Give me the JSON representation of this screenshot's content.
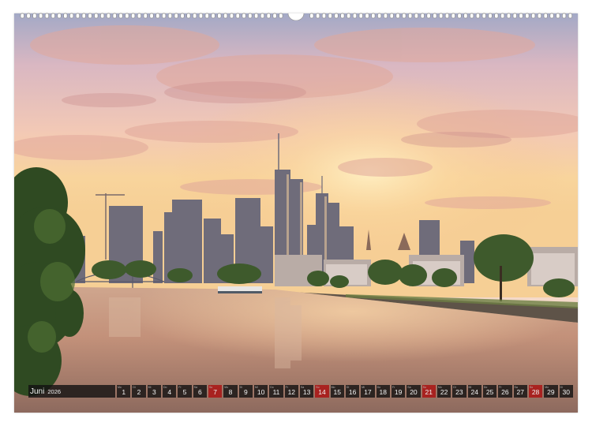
{
  "calendar": {
    "month": "Juni",
    "year": "2026",
    "days": [
      {
        "wd": "Mo",
        "n": "1",
        "sun": false
      },
      {
        "wd": "Di",
        "n": "2",
        "sun": false
      },
      {
        "wd": "Mi",
        "n": "3",
        "sun": false
      },
      {
        "wd": "Do",
        "n": "4",
        "sun": false
      },
      {
        "wd": "Fr",
        "n": "5",
        "sun": false
      },
      {
        "wd": "Sa",
        "n": "6",
        "sun": false
      },
      {
        "wd": "So",
        "n": "7",
        "sun": true
      },
      {
        "wd": "Mo",
        "n": "8",
        "sun": false
      },
      {
        "wd": "Di",
        "n": "9",
        "sun": false
      },
      {
        "wd": "Mi",
        "n": "10",
        "sun": false
      },
      {
        "wd": "Do",
        "n": "11",
        "sun": false
      },
      {
        "wd": "Fr",
        "n": "12",
        "sun": false
      },
      {
        "wd": "Sa",
        "n": "13",
        "sun": false
      },
      {
        "wd": "So",
        "n": "14",
        "sun": true
      },
      {
        "wd": "Mo",
        "n": "15",
        "sun": false
      },
      {
        "wd": "Di",
        "n": "16",
        "sun": false
      },
      {
        "wd": "Mi",
        "n": "17",
        "sun": false
      },
      {
        "wd": "Do",
        "n": "18",
        "sun": false
      },
      {
        "wd": "Fr",
        "n": "19",
        "sun": false
      },
      {
        "wd": "Sa",
        "n": "20",
        "sun": false
      },
      {
        "wd": "So",
        "n": "21",
        "sun": true
      },
      {
        "wd": "Mo",
        "n": "22",
        "sun": false
      },
      {
        "wd": "Di",
        "n": "23",
        "sun": false
      },
      {
        "wd": "Mi",
        "n": "24",
        "sun": false
      },
      {
        "wd": "Do",
        "n": "25",
        "sun": false
      },
      {
        "wd": "Fr",
        "n": "26",
        "sun": false
      },
      {
        "wd": "Sa",
        "n": "27",
        "sun": false
      },
      {
        "wd": "So",
        "n": "28",
        "sun": true
      },
      {
        "wd": "Mo",
        "n": "29",
        "sun": false
      },
      {
        "wd": "Di",
        "n": "30",
        "sun": false
      }
    ]
  },
  "colors": {
    "sky_top": "#9aa6c8",
    "sky_glow": "#f7c88e",
    "water": "#c9967a",
    "sunday": "#aa1414",
    "bar": "#141212"
  }
}
